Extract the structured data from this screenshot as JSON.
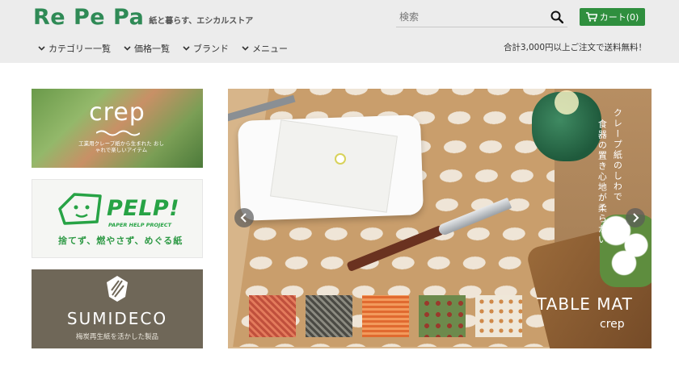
{
  "header": {
    "logo": "Re Pe Pa",
    "tagline": "紙と暮らす、エシカルストア",
    "search_placeholder": "検索",
    "cart_label": "カート(0)",
    "nav": [
      "カテゴリー一覧",
      "価格一覧",
      "ブランド",
      "メニュー"
    ],
    "shipping_notice": "合計3,000円以上ご注文で送料無料！"
  },
  "sidebar_banners": [
    {
      "title": "crep",
      "subtitle": "工業用クレープ紙から生まれた おしゃれで楽しいアイテム"
    },
    {
      "title": "PELP!",
      "project": "PAPER HELP PROJECT",
      "tagline": "捨てず、燃やさず、めぐる紙"
    },
    {
      "title": "SUMIDECO",
      "subtitle": "梅炭再生紙を活かした製品"
    }
  ],
  "hero": {
    "vertical_text_1": "クレープ紙のしわで",
    "vertical_text_2": "食器の置き心地が柔らかい",
    "title": "TABLE MAT",
    "brand": "crep"
  },
  "colors": {
    "brand_green": "#2f8a56",
    "cart_green": "#2f8f3e",
    "header_bg": "#ececec"
  },
  "icons": {
    "search": "search-icon",
    "cart": "cart-icon",
    "chevron": "chevron-down-icon",
    "arrow_left": "arrow-left-icon",
    "arrow_right": "arrow-right-icon"
  }
}
